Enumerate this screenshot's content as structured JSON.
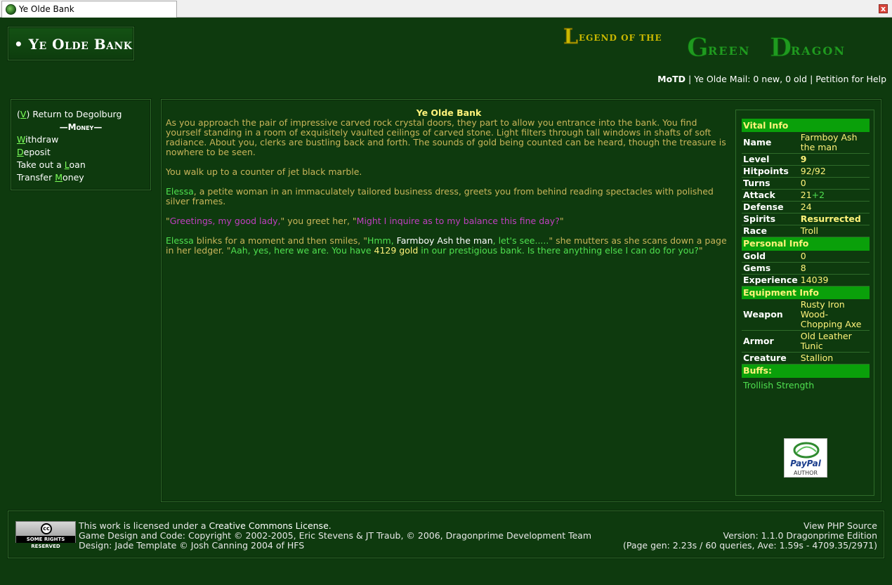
{
  "window": {
    "tab_title": "Ye Olde Bank",
    "close_label": "x"
  },
  "header": {
    "page_title": "• Ye Olde Bank",
    "logo_text": "Legend of the Green Dragon",
    "topnav": {
      "motd": "MoTD",
      "sep": "|",
      "mail": "Ye Olde Mail: 0 new, 0 old",
      "petition": "Petition for Help"
    }
  },
  "nav": {
    "return_open": "(",
    "return_key": "V",
    "return_close": ")",
    "return_label": " Return to Degolburg",
    "section_header": "Money",
    "items": [
      {
        "key": "W",
        "pre": "",
        "post": "ithdraw"
      },
      {
        "key": "D",
        "pre": "",
        "post": "eposit"
      },
      {
        "key": "L",
        "pre": "Take out a ",
        "post": "oan"
      },
      {
        "key": "M",
        "pre": "Transfer ",
        "post": "oney"
      }
    ]
  },
  "main": {
    "title": "Ye Olde Bank",
    "p1": "As you approach the pair of impressive carved rock crystal doors, they part to allow you entrance into the bank. You find yourself standing in a room of exquisitely vaulted ceilings of carved stone. Light filters through tall windows in shafts of soft radiance. About you, clerks are bustling back and forth. The sounds of gold being counted can be heard, though the treasure is nowhere to be seen.",
    "p2": "You walk up to a counter of jet black marble.",
    "p3_name": "Elessa",
    "p3_rest": ", a petite woman in an immaculately tailored business dress, greets you from behind reading spectacles with polished silver frames.",
    "p4_q1": "\"",
    "p4_greet": "Greetings, my good lady,",
    "p4_mid": "\" you greet her, \"",
    "p4_ask": "Might I inquire as to my balance this fine day?",
    "p4_end": "\"",
    "p5_name": "Elessa",
    "p5_a": " blinks for a moment and then smiles, \"",
    "p5_hmm": "Hmm, ",
    "p5_player": "Farmboy Ash the man",
    "p5_see": ", let's see.....",
    "p5_b": "\" she mutters as she scans down a page in her ledger. \"",
    "p5_c": "Aah, yes, here we are. You have ",
    "p5_gold": "4129 gold",
    "p5_d": " in our prestigious bank. Is there anything else I can do for you?",
    "p5_e": "\""
  },
  "stats": {
    "vital_header": "Vital Info",
    "vital": [
      {
        "label": "Name",
        "value": "Farmboy Ash the man"
      },
      {
        "label": "Level",
        "value": "9"
      },
      {
        "label": "Hitpoints",
        "value": "92/92"
      },
      {
        "label": "Turns",
        "value": "0"
      },
      {
        "label": "Attack",
        "value": "21",
        "extra": "+2"
      },
      {
        "label": "Defense",
        "value": "24"
      },
      {
        "label": "Spirits",
        "value": "Resurrected"
      },
      {
        "label": "Race",
        "value": "Troll"
      }
    ],
    "personal_header": "Personal Info",
    "personal": [
      {
        "label": "Gold",
        "value": "0"
      },
      {
        "label": "Gems",
        "value": "8"
      },
      {
        "label": "Experience",
        "value": "14039"
      }
    ],
    "equipment_header": "Equipment Info",
    "equipment": [
      {
        "label": "Weapon",
        "value": "Rusty Iron Wood-Chopping Axe"
      },
      {
        "label": "Armor",
        "value": "Old Leather Tunic"
      },
      {
        "label": "Creature",
        "value": "Stallion"
      }
    ],
    "buffs_header": "Buffs:",
    "buffs": "Trollish Strength",
    "paypal_label": "PayPal",
    "paypal_sub": "AUTHOR"
  },
  "footer": {
    "cc_badge_top": "cc",
    "cc_badge_bottom": "SOME RIGHTS RESERVED",
    "license_pre": "This work is licensed under a ",
    "license_link": "Creative Commons License",
    "license_post": ".",
    "copyright": "Game Design and Code: Copyright © 2002-2005, Eric Stevens & JT Traub, © 2006, Dragonprime Development Team",
    "design": "Design: Jade Template © Josh Canning 2004 of HFS",
    "view_source": "View PHP Source",
    "version": "Version: 1.1.0 Dragonprime Edition",
    "pagegen": "(Page gen: 2.23s / 60 queries, Ave: 1.59s - 4709.35/2971)"
  }
}
